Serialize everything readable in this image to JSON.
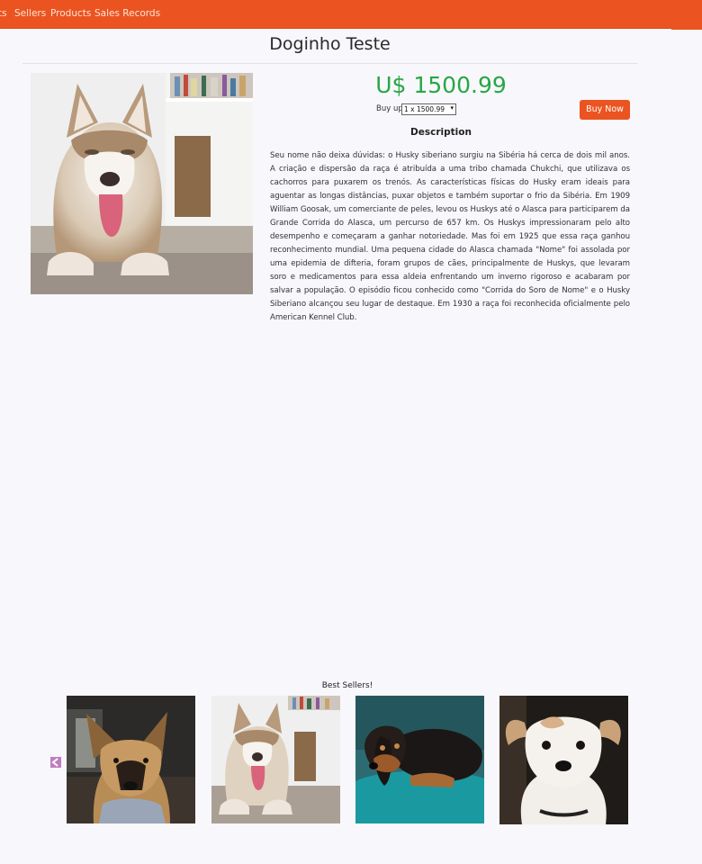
{
  "nav": {
    "items": [
      {
        "label": "ts"
      },
      {
        "label": "Sellers"
      },
      {
        "label": "Products"
      },
      {
        "label": "Sales Records"
      }
    ]
  },
  "product": {
    "title": "Doginho Teste",
    "price": "U$ 1500.99",
    "buy_up_label": "Buy up",
    "quantity_selected": "1 x 1500.99",
    "buy_button": "Buy Now",
    "description_heading": "Description",
    "description": "Seu nome não deixa dúvidas: o Husky siberiano surgiu na Sibéria há cerca de dois mil anos. A criação e dispersão da raça é atribuída a uma tribo chamada Chukchi, que utilizava os cachorros para puxarem os trenós. As características físicas do Husky eram ideais para aguentar as longas distâncias, puxar objetos e também suportar o frio da Sibéria. Em 1909 William Goosak, um comerciante de peles, levou os Huskys até o Alasca para participarem da Grande Corrida do Alasca, um percurso de 657 km. Os Huskys impressionaram pelo alto desempenho e começaram a ganhar notoriedade. Mas foi em 1925 que essa raça ganhou reconhecimento mundial. Uma pequena cidade do Alasca chamada \"Nome\" foi assolada por uma epidemia de difteria, foram grupos de cães, principalmente de Huskys, que levaram soro e medicamentos para essa aldeia enfrentando um inverno rigoroso e acabaram por salvar a população. O episódio ficou conhecido como \"Corrida do Soro de Nome\" e o Husky Siberiano alcançou seu lugar de destaque. Em 1930 a raça foi reconhecida oficialmente pelo American Kennel Club."
  },
  "best_sellers": {
    "heading": "Best Sellers!",
    "items": [
      {
        "image": "german-shepherd-photo"
      },
      {
        "image": "husky-puppy-photo"
      },
      {
        "image": "dachshund-photo"
      },
      {
        "image": "white-terrier-photo"
      }
    ]
  },
  "colors": {
    "brand": "#eb5420",
    "price": "#28a745",
    "arrow": "#c07ec0",
    "background": "#f7f7fc"
  }
}
